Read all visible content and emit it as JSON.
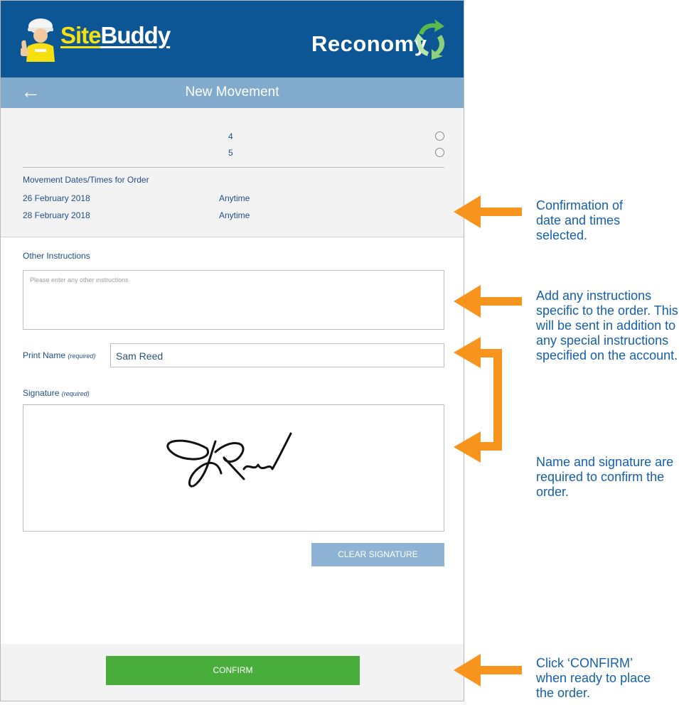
{
  "header": {
    "sitebuddy_logo": {
      "site": "Site",
      "buddy": "Buddy"
    },
    "reconomy_logo": "Reconomy",
    "nav_title": "New Movement",
    "back_arrow": "←"
  },
  "options": [
    {
      "value": "4",
      "selected": false
    },
    {
      "value": "5",
      "selected": false
    }
  ],
  "movement_dates": {
    "title": "Movement Dates/Times for Order",
    "rows": [
      {
        "date": "26 February 2018",
        "time": "Anytime"
      },
      {
        "date": "28 February 2018",
        "time": "Anytime"
      }
    ]
  },
  "other_instructions": {
    "label": "Other Instructions",
    "placeholder": "Please enter any other instructions",
    "value": ""
  },
  "print_name": {
    "label": "Print Name",
    "required_text": "(required)",
    "value": "Sam Reed"
  },
  "signature": {
    "label": "Signature",
    "required_text": "(required)"
  },
  "buttons": {
    "clear_signature": "CLEAR SIGNATURE",
    "confirm": "CONFIRM"
  },
  "callouts": [
    {
      "text": "Confirmation of date and times selected."
    },
    {
      "text": "Add any instructions specific to the order. This will be sent in addition to any special instructions specified on the account."
    },
    {
      "text": "Name and signature are required to confirm the order."
    },
    {
      "text": "Click ‘CONFIRM’ when ready to place the order."
    }
  ],
  "colors": {
    "brand_blue": "#0d5696",
    "nav_blue": "#81aacc",
    "text_blue": "#1f4f8a",
    "confirm_green": "#48ad3a",
    "callout_orange": "#f7941d",
    "callout_text": "#1660aa"
  }
}
